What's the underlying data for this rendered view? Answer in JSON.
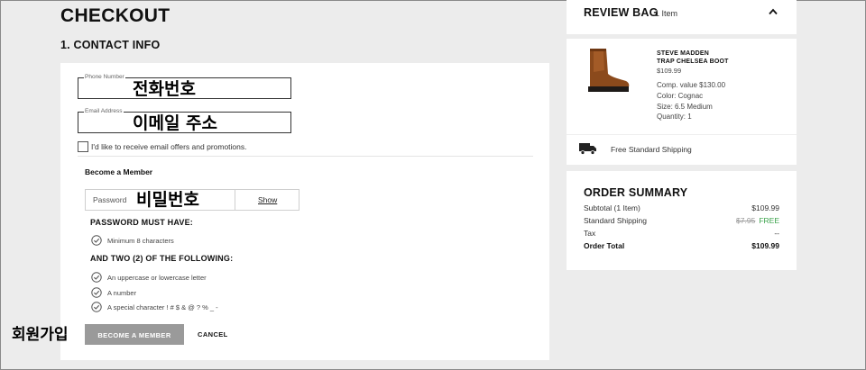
{
  "page": {
    "title": "CHECKOUT"
  },
  "contact": {
    "section_title": "1. CONTACT INFO",
    "phone": {
      "label": "Phone Number",
      "value": "전화번호"
    },
    "email": {
      "label": "Email Address",
      "value": "이메일 주소"
    },
    "offers_label": "I'd like to receive email offers and promotions."
  },
  "member": {
    "heading": "Become a Member",
    "password": {
      "label": "Password",
      "value": "비밀번호",
      "show_label": "Show"
    },
    "must_have_heading": "PASSWORD MUST HAVE:",
    "must_have": [
      "Minimum 8 characters"
    ],
    "two_of_heading": "AND TWO (2) OF THE FOLLOWING:",
    "two_of": [
      "An uppercase or lowercase letter",
      "A number",
      "A special character ! # $ & @ ? % _ -"
    ],
    "become_button": "BECOME A MEMBER",
    "cancel_button": "CANCEL",
    "korean_annotation": "회원가입"
  },
  "review_bag": {
    "title": "REVIEW BAG",
    "count": "1 Item",
    "product": {
      "brand": "STEVE MADDEN",
      "name": "TRAP CHELSEA BOOT",
      "price": "$109.99",
      "comp_value": "Comp. value $130.00",
      "color": "Color: Cognac",
      "size": "Size: 6.5 Medium",
      "quantity": "Quantity: 1"
    },
    "shipping": "Free Standard Shipping"
  },
  "summary": {
    "title": "ORDER SUMMARY",
    "rows": [
      {
        "label": "Subtotal (1 Item)",
        "value": "$109.99"
      },
      {
        "label": "Standard Shipping",
        "old_value": "$7.95",
        "value": "FREE"
      },
      {
        "label": "Tax",
        "value": "--"
      },
      {
        "label": "Order Total",
        "value": "$109.99"
      }
    ]
  },
  "colors": {
    "free": "#3aa24a",
    "button_gray": "#9a9a9a",
    "boot": "#8b4a1c"
  }
}
